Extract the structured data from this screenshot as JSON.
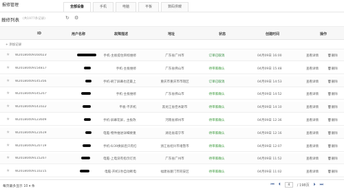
{
  "app": {
    "title": "报修管理"
  },
  "tabs": [
    {
      "label": "全部设备",
      "active": true
    },
    {
      "label": "手机",
      "active": false
    },
    {
      "label": "电脑",
      "active": false
    },
    {
      "label": "平板",
      "active": false
    },
    {
      "label": "数码供暖",
      "active": false
    }
  ],
  "section": {
    "title": "报修列表",
    "count_text": "(共1977条记录)",
    "refresh_icon": "refresh-icon",
    "settings_icon": "gear-icon"
  },
  "columns": [
    "ID",
    "用户名称",
    "故障描述",
    "地址",
    "状态",
    "创建时间",
    "操作"
  ],
  "add_label": "+ 添加记录",
  "rows": [
    {
      "id": "W201804091600239502...",
      "fault": "手机-主板提住目标维修",
      "addr": "广东省广州市",
      "status": "订单已取消",
      "time": "04月09日 16:00",
      "op1": "查看详情",
      "op2": "删除"
    },
    {
      "id": "W201804091548178644...",
      "fault": "手机-主板维修",
      "addr": "广东省佛山市",
      "status": "待带家确认",
      "time": "04月09日 15:48",
      "op1": "查看详情",
      "op2": "删除"
    },
    {
      "id": "W201804091453565991...",
      "fault": "手机-刷了屏幕也还最上...",
      "addr": "重庆市重庆市市辖区",
      "status": "订单已取消",
      "time": "04月09日 14:53",
      "op1": "查看详情",
      "op2": "删除"
    },
    {
      "id": "W201804091452079645...",
      "fault": "手机-主板维修",
      "addr": "广东省佛山市",
      "status": "待带家确认",
      "time": "04月09日 14:52",
      "op1": "查看详情",
      "op2": "删除"
    },
    {
      "id": "W201804091410226157...",
      "fault": "平板-不开机",
      "addr": "黑龙江省佳木斯市",
      "status": "待带家确认",
      "time": "04月09日 14:10",
      "op1": "查看详情",
      "op2": "删除"
    },
    {
      "id": "W201804091236092021...",
      "fault": "手机-屏幕花屏，主板改坏...",
      "addr": "河南省郑州市",
      "status": "待带家确认",
      "time": "04月09日 12:36",
      "op1": "查看详情",
      "op2": "删除"
    },
    {
      "id": "W201804091216198074...",
      "fault": "电脑-物件维进详细要重启",
      "addr": "湖北省咸宁市",
      "status": "待带家确认",
      "time": "04月09日 12:16",
      "op1": "查看详情",
      "op2": "删除"
    },
    {
      "id": "W201804091207191143...",
      "fault": "手机-6/39换屏后只有红光...",
      "addr": "浙江省绍兴市诸暨市",
      "status": "待带家确认",
      "time": "04月09日 12:07",
      "op1": "查看详情",
      "op2": "删除"
    },
    {
      "id": "W201804091152074768...",
      "fault": "电脑-上电没有指示灯亮...",
      "addr": "广东省广州市",
      "status": "待带家确认",
      "time": "04月09日 11:52",
      "op1": "查看详情",
      "op2": "删除"
    },
    {
      "id": "W201804091102153502...",
      "fault": "电脑-开机1秒自动断电",
      "addr": "福建省厦门市同安区",
      "status": "待带家确认",
      "time": "04月09日 11:02",
      "op1": "查看详情",
      "op2": "删除"
    }
  ],
  "footer": {
    "per_page_label": "每页最多显示",
    "per_page_value": "10",
    "per_page_suffix": "条",
    "current_page": "4",
    "total_pages": "/ 198页"
  }
}
